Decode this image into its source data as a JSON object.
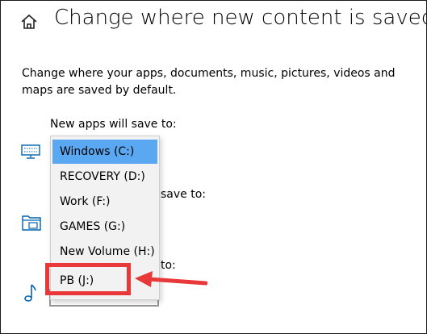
{
  "header": {
    "title": "Change where new content is saved",
    "home_icon": "home-icon"
  },
  "description": "Change where your apps, documents, music, pictures, videos and maps are saved by default.",
  "sections": {
    "apps_label": "New apps will save to:",
    "docs_label_tail": "save to:",
    "music_label_tail": "to:"
  },
  "dropdown": {
    "selected": "Windows (C:)",
    "options": [
      {
        "label": "Windows (C:)"
      },
      {
        "label": "RECOVERY (D:)"
      },
      {
        "label": "Work (F:)"
      },
      {
        "label": "GAMES (G:)"
      },
      {
        "label": "New Volume (H:)"
      },
      {
        "label": "PB (J:)"
      }
    ]
  },
  "annotation": {
    "highlighted_option": "PB (J:)",
    "color": "#e8383a"
  },
  "colors": {
    "selection": "#5aa8f2",
    "icon": "#0063b1",
    "list_background": "#f2f2f2"
  }
}
